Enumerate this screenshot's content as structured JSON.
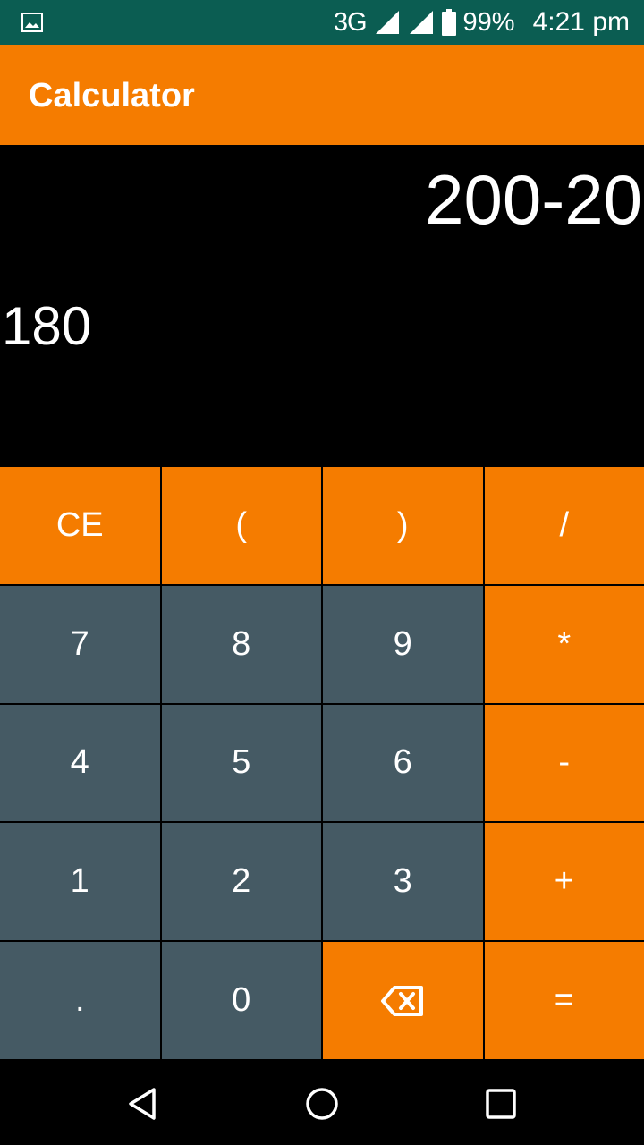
{
  "status_bar": {
    "network": "3G",
    "battery": "99%",
    "time": "4:21 pm",
    "icons": [
      "image-notification-icon",
      "signal-icon",
      "signal-icon-2",
      "battery-icon"
    ]
  },
  "app_bar": {
    "title": "Calculator"
  },
  "display": {
    "expression": "200-20",
    "result": "180"
  },
  "keys": [
    {
      "label": "CE",
      "style": "orange",
      "name": "clear-button"
    },
    {
      "label": "(",
      "style": "orange",
      "name": "open-paren-button"
    },
    {
      "label": ")",
      "style": "orange",
      "name": "close-paren-button"
    },
    {
      "label": "/",
      "style": "orange",
      "name": "divide-button"
    },
    {
      "label": "7",
      "style": "slate",
      "name": "digit-7-button"
    },
    {
      "label": "8",
      "style": "slate",
      "name": "digit-8-button"
    },
    {
      "label": "9",
      "style": "slate",
      "name": "digit-9-button"
    },
    {
      "label": "*",
      "style": "orange",
      "name": "multiply-button"
    },
    {
      "label": "4",
      "style": "slate",
      "name": "digit-4-button"
    },
    {
      "label": "5",
      "style": "slate",
      "name": "digit-5-button"
    },
    {
      "label": "6",
      "style": "slate",
      "name": "digit-6-button"
    },
    {
      "label": "-",
      "style": "orange",
      "name": "subtract-button"
    },
    {
      "label": "1",
      "style": "slate",
      "name": "digit-1-button"
    },
    {
      "label": "2",
      "style": "slate",
      "name": "digit-2-button"
    },
    {
      "label": "3",
      "style": "slate",
      "name": "digit-3-button"
    },
    {
      "label": "+",
      "style": "orange",
      "name": "add-button"
    },
    {
      "label": ".",
      "style": "slate",
      "name": "decimal-button"
    },
    {
      "label": "0",
      "style": "slate",
      "name": "digit-0-button"
    },
    {
      "label": "",
      "style": "orange",
      "name": "backspace-button",
      "icon": "backspace-icon"
    },
    {
      "label": "=",
      "style": "orange",
      "name": "equals-button"
    }
  ],
  "colors": {
    "status_bar": "#0b5d52",
    "accent": "#f57c00",
    "key_slate": "#455a64",
    "background": "#000000"
  },
  "nav_bar": {
    "icons": [
      "back-icon",
      "home-icon",
      "recent-apps-icon"
    ]
  }
}
